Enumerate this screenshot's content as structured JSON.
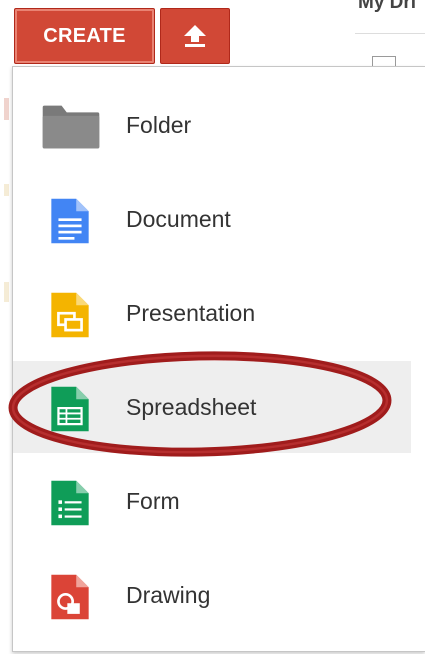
{
  "toolbar": {
    "create_label": "CREATE",
    "upload_icon": "upload-arrow-icon",
    "mydrive_partial_label": "My Dri"
  },
  "menu": {
    "items": [
      {
        "label": "Folder",
        "icon": "folder-icon",
        "color": "#777777"
      },
      {
        "label": "Document",
        "icon": "document-icon",
        "color": "#4285f4"
      },
      {
        "label": "Presentation",
        "icon": "presentation-icon",
        "color": "#f4b400"
      },
      {
        "label": "Spreadsheet",
        "icon": "spreadsheet-icon",
        "color": "#0f9d58",
        "highlighted": true
      },
      {
        "label": "Form",
        "icon": "form-icon",
        "color": "#0f9d58"
      },
      {
        "label": "Drawing",
        "icon": "drawing-icon",
        "color": "#db4437"
      }
    ]
  },
  "colors": {
    "button_red": "#d14836",
    "annotation_ring": "#a01c1c",
    "hover_gray": "#eeeeee"
  }
}
